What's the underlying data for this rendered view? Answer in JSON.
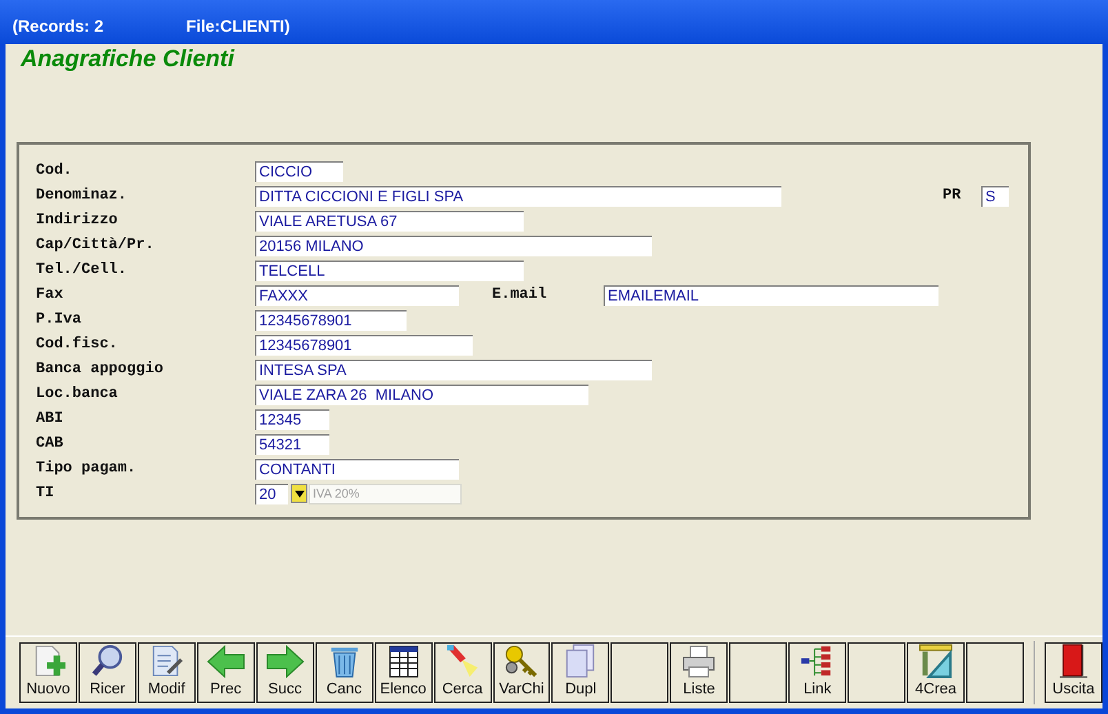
{
  "window": {
    "title_records": "(Records: 2",
    "title_file": "File:CLIENTI)"
  },
  "heading": "Anagrafiche Clienti",
  "fields": [
    {
      "label": "Cod.",
      "value": "CICCIO",
      "kind": "text"
    },
    {
      "label": "Denominaz.",
      "value": "DITTA CICCIONI E FIGLI SPA",
      "kind": "text",
      "side_label": "PR",
      "side_value": "S"
    },
    {
      "label": "Indirizzo",
      "value": "VIALE ARETUSA 67",
      "kind": "text"
    },
    {
      "label": "Cap/Città/Pr.",
      "value": "20156 MILANO",
      "kind": "text"
    },
    {
      "label": "Tel./Cell.",
      "value": "TELCELL",
      "kind": "text"
    },
    {
      "label": "Fax",
      "value": "FAXXX",
      "kind": "text",
      "side_label": "E.mail",
      "side_value": "EMAILEMAIL"
    },
    {
      "label": "P.Iva",
      "value": "12345678901",
      "kind": "text"
    },
    {
      "label": "Cod.fisc.",
      "value": "12345678901",
      "kind": "text"
    },
    {
      "label": "Banca appoggio",
      "value": "INTESA SPA",
      "kind": "text"
    },
    {
      "label": "Loc.banca",
      "value": "VIALE ZARA 26  MILANO",
      "kind": "text"
    },
    {
      "label": "ABI",
      "value": "12345",
      "kind": "text"
    },
    {
      "label": "CAB",
      "value": "54321",
      "kind": "text"
    },
    {
      "label": "Tipo pagam.",
      "value": "CONTANTI",
      "kind": "text"
    },
    {
      "label": "TI",
      "value": "20",
      "kind": "combo",
      "description": "IVA 20%"
    }
  ],
  "toolbar": [
    {
      "label": "Nuovo",
      "kind": "new"
    },
    {
      "label": "Ricer",
      "kind": "search"
    },
    {
      "label": "Modif",
      "kind": "edit"
    },
    {
      "label": "Prec",
      "kind": "prev"
    },
    {
      "label": "Succ",
      "kind": "next"
    },
    {
      "label": "Canc",
      "kind": "trash"
    },
    {
      "label": "Elenco",
      "kind": "table"
    },
    {
      "label": "Cerca",
      "kind": "torch"
    },
    {
      "label": "VarChi",
      "kind": "keys"
    },
    {
      "label": "Dupl",
      "kind": "copy"
    },
    {
      "kind": "blank"
    },
    {
      "label": "Liste",
      "kind": "print"
    },
    {
      "kind": "blank"
    },
    {
      "label": "Link",
      "kind": "link"
    },
    {
      "kind": "blank"
    },
    {
      "label": "4Crea",
      "kind": "tools"
    },
    {
      "kind": "blank"
    },
    {
      "label": "Uscita",
      "kind": "door"
    }
  ]
}
